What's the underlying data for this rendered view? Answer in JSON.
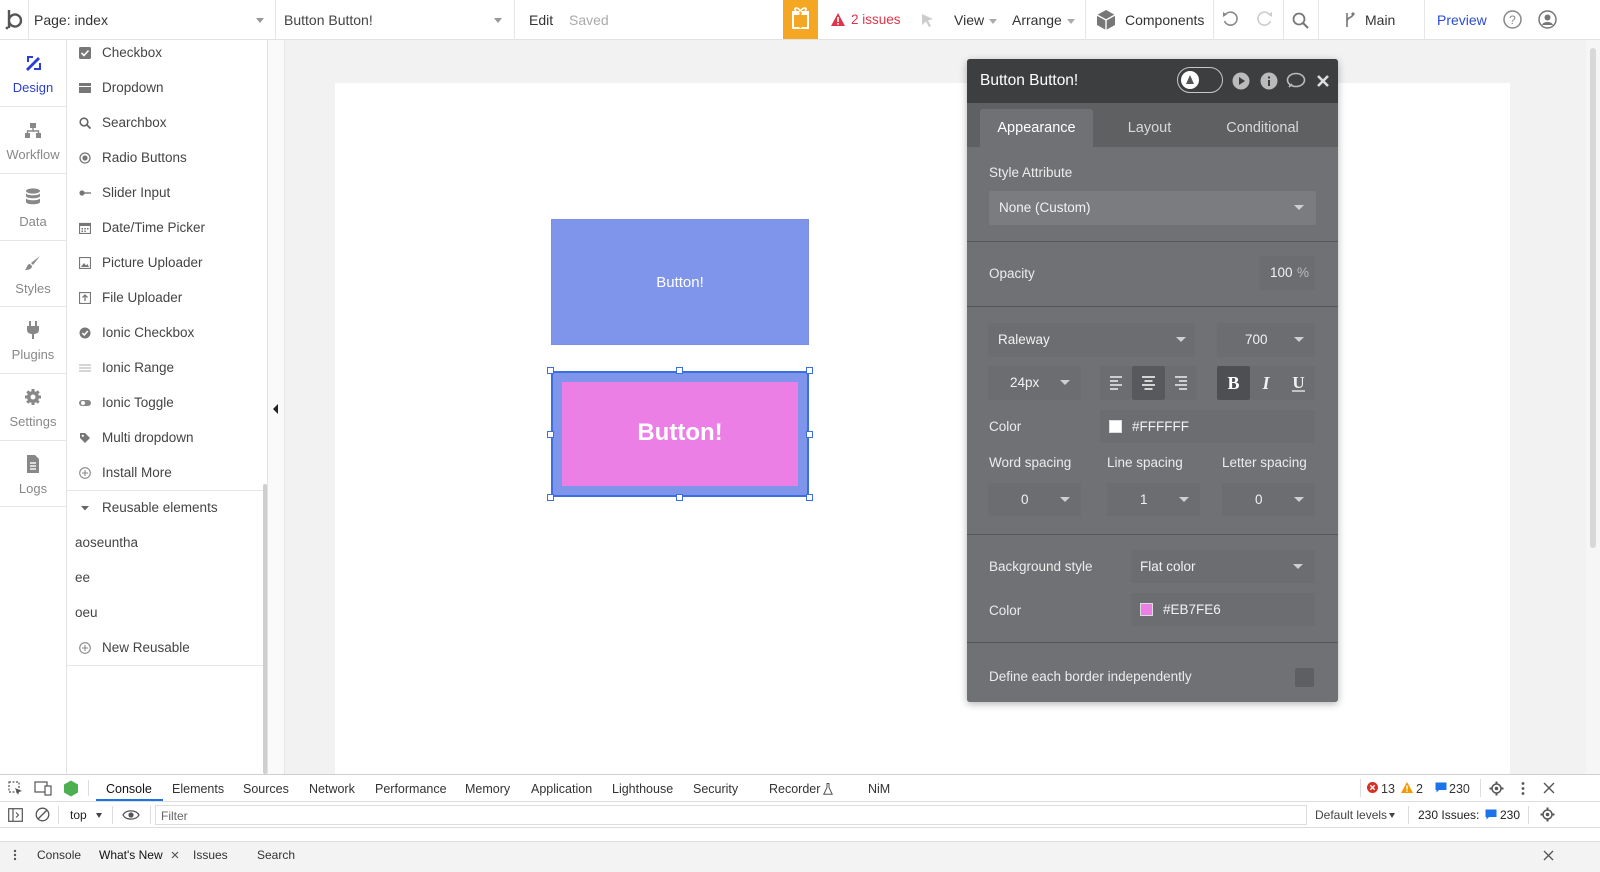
{
  "topbar": {
    "page_label": "Page: index",
    "element_selector": "Button Button!",
    "edit": "Edit",
    "saved": "Saved",
    "issues": "2 issues",
    "view": "View",
    "arrange": "Arrange",
    "components": "Components",
    "branch": "Main",
    "preview": "Preview"
  },
  "leftnav": {
    "items": [
      {
        "label": "Design",
        "icon": "design-icon"
      },
      {
        "label": "Workflow",
        "icon": "workflow-icon"
      },
      {
        "label": "Data",
        "icon": "database-icon"
      },
      {
        "label": "Styles",
        "icon": "brush-icon"
      },
      {
        "label": "Plugins",
        "icon": "plug-icon"
      },
      {
        "label": "Settings",
        "icon": "gear-icon"
      },
      {
        "label": "Logs",
        "icon": "document-icon"
      }
    ]
  },
  "elements": {
    "items": [
      {
        "label": "Checkbox"
      },
      {
        "label": "Dropdown"
      },
      {
        "label": "Searchbox"
      },
      {
        "label": "Radio Buttons"
      },
      {
        "label": "Slider Input"
      },
      {
        "label": "Date/Time Picker"
      },
      {
        "label": "Picture Uploader"
      },
      {
        "label": "File Uploader"
      },
      {
        "label": "Ionic Checkbox"
      },
      {
        "label": "Ionic Range"
      },
      {
        "label": "Ionic Toggle"
      },
      {
        "label": "Multi dropdown"
      },
      {
        "label": "Install More"
      }
    ],
    "reusable_header": "Reusable elements",
    "reusables": [
      "aoseuntha",
      "ee",
      "oeu"
    ],
    "new_reusable": "New Reusable"
  },
  "canvas": {
    "button1_label": "Button!",
    "button2_label": "Button!",
    "button1_color": "#7F95EB",
    "button2_color": "#EB7FE6"
  },
  "editor": {
    "title": "Button Button!",
    "tabs": [
      "Appearance",
      "Layout",
      "Conditional"
    ],
    "style_attribute_label": "Style Attribute",
    "style_attribute_value": "None (Custom)",
    "opacity_label": "Opacity",
    "opacity_value": "100",
    "opacity_unit": "%",
    "font_family": "Raleway",
    "font_weight": "700",
    "font_size": "24px",
    "color_label": "Color",
    "font_color": "#FFFFFF",
    "word_spacing_label": "Word spacing",
    "line_spacing_label": "Line spacing",
    "letter_spacing_label": "Letter spacing",
    "word_spacing": "0",
    "line_spacing": "1",
    "letter_spacing": "0",
    "bg_style_label": "Background style",
    "bg_style_value": "Flat color",
    "bg_color_label": "Color",
    "bg_color": "#EB7FE6",
    "border_label": "Define each border independently"
  },
  "devtools": {
    "tabs": [
      "Console",
      "Elements",
      "Sources",
      "Network",
      "Performance",
      "Memory",
      "Application",
      "Lighthouse",
      "Security",
      "Recorder",
      "NiM"
    ],
    "errors": "13",
    "warnings": "2",
    "messages": "230",
    "context": "top",
    "filter_placeholder": "Filter",
    "levels": "Default levels",
    "issues_label": "230 Issues:",
    "issues_count": "230",
    "drawer_tabs": [
      "Console",
      "What's New",
      "Issues",
      "Search"
    ]
  }
}
